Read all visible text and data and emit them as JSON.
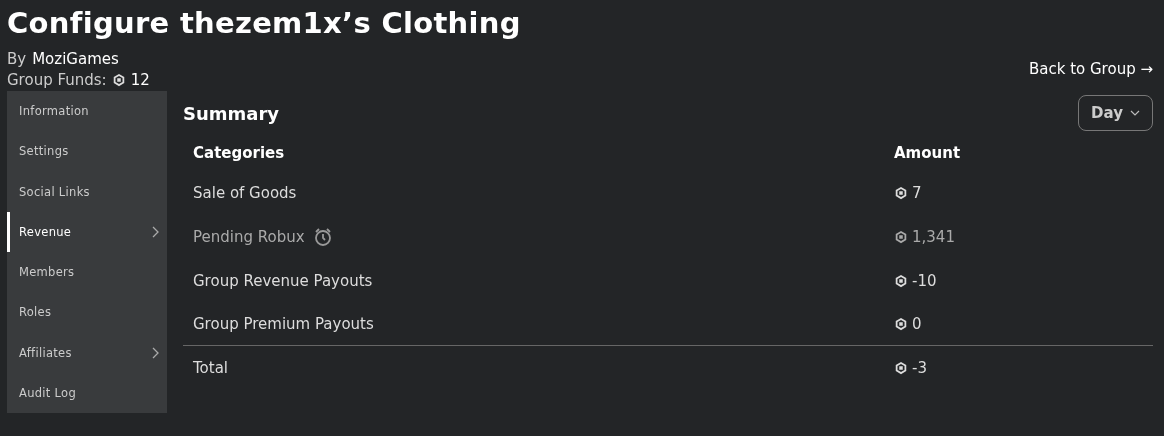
{
  "title": "Configure thezem1x’s Clothing",
  "owner": {
    "prefix": "By",
    "name": "MoziGames"
  },
  "funds": {
    "label": "Group Funds:",
    "amount": "12"
  },
  "back_link": "Back to Group →",
  "sidebar": {
    "items": [
      {
        "label": "Information",
        "selected": false,
        "has_submenu": false
      },
      {
        "label": "Settings",
        "selected": false,
        "has_submenu": false
      },
      {
        "label": "Social Links",
        "selected": false,
        "has_submenu": false
      },
      {
        "label": "Revenue",
        "selected": true,
        "has_submenu": true
      },
      {
        "label": "Members",
        "selected": false,
        "has_submenu": false
      },
      {
        "label": "Roles",
        "selected": false,
        "has_submenu": false
      },
      {
        "label": "Affiliates",
        "selected": false,
        "has_submenu": true
      },
      {
        "label": "Audit Log",
        "selected": false,
        "has_submenu": false
      }
    ]
  },
  "summary": {
    "title": "Summary",
    "period": "Day",
    "columns": [
      "Categories",
      "Amount"
    ],
    "rows": [
      {
        "kind": "item",
        "category": "Sale of Goods",
        "amount": "7",
        "pending": false
      },
      {
        "kind": "item",
        "category": "Pending Robux",
        "amount": "1,341",
        "pending": true
      },
      {
        "kind": "item",
        "category": "Group Revenue Payouts",
        "amount": "-10",
        "pending": false
      },
      {
        "kind": "item",
        "category": "Group Premium Payouts",
        "amount": "0",
        "pending": false
      },
      {
        "kind": "total",
        "category": "Total",
        "amount": "-3",
        "pending": false
      }
    ]
  }
}
